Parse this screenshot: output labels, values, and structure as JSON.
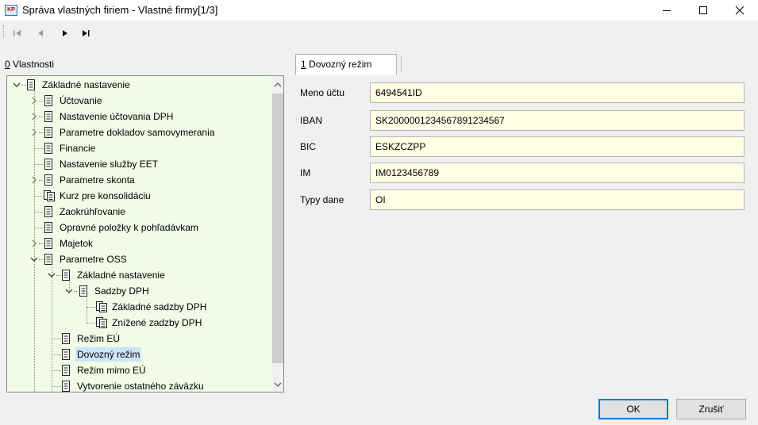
{
  "window": {
    "title": "Správa vlastných firiem - Vlastné firmy[1/3]",
    "app_icon_text": "KP"
  },
  "toolbar": {
    "nav": [
      "first-record",
      "previous-record",
      "next-record",
      "last-record"
    ]
  },
  "properties": {
    "label_prefix": "0",
    "label": " Vlastnosti"
  },
  "tree": {
    "items": [
      {
        "label": "Základné nastavenie",
        "level": 0,
        "expander": "expanded",
        "icon": "document-icon"
      },
      {
        "label": "Účtovanie",
        "level": 1,
        "expander": "collapsed",
        "icon": "document-icon"
      },
      {
        "label": "Nastavenie účtovania DPH",
        "level": 1,
        "expander": "collapsed",
        "icon": "document-icon"
      },
      {
        "label": "Parametre dokladov samovymerania",
        "level": 1,
        "expander": "collapsed",
        "icon": "document-icon"
      },
      {
        "label": "Financie",
        "level": 1,
        "expander": "none",
        "icon": "document-icon"
      },
      {
        "label": "Nastavenie služby EET",
        "level": 1,
        "expander": "none",
        "icon": "document-icon"
      },
      {
        "label": "Parametre skonta",
        "level": 1,
        "expander": "collapsed",
        "icon": "document-icon"
      },
      {
        "label": "Kurz pre konsolidáciu",
        "level": 1,
        "expander": "none",
        "icon": "documents-icon"
      },
      {
        "label": "Zaokrúhľovanie",
        "level": 1,
        "expander": "none",
        "icon": "document-icon"
      },
      {
        "label": "Opravné položky k pohľadávkam",
        "level": 1,
        "expander": "none",
        "icon": "document-icon"
      },
      {
        "label": "Majetok",
        "level": 1,
        "expander": "collapsed",
        "icon": "document-icon"
      },
      {
        "label": "Parametre OSS",
        "level": 1,
        "expander": "expanded",
        "icon": "document-icon"
      },
      {
        "label": "Základné nastavenie",
        "level": 2,
        "expander": "expanded",
        "icon": "document-icon"
      },
      {
        "label": "Sadzby DPH",
        "level": 3,
        "expander": "expanded",
        "icon": "document-icon"
      },
      {
        "label": "Základné sadzby DPH",
        "level": 4,
        "expander": "none",
        "icon": "documents-icon"
      },
      {
        "label": "Znížené zadzby DPH",
        "level": 4,
        "expander": "none",
        "icon": "documents-icon"
      },
      {
        "label": "Režim EÚ",
        "level": 2,
        "expander": "none",
        "icon": "document-icon"
      },
      {
        "label": "Dovozný režim",
        "level": 2,
        "expander": "none",
        "icon": "document-icon",
        "selected": true
      },
      {
        "label": "Režim mimo EÚ",
        "level": 2,
        "expander": "none",
        "icon": "document-icon"
      },
      {
        "label": "Vytvorenie ostatného záväzku",
        "level": 2,
        "expander": "none",
        "icon": "document-icon"
      }
    ]
  },
  "tab": {
    "prefix": "1",
    "label": " Dovozný režim"
  },
  "form": {
    "fields": [
      {
        "label": "Meno účtu",
        "value": "6494541ID"
      },
      {
        "label": "IBAN",
        "value": "SK2000001234567891234567"
      },
      {
        "label": "BIC",
        "value": "ESKZCZPP"
      },
      {
        "label": "IM",
        "value": "IM0123456789"
      },
      {
        "label": "Typy dane",
        "value": "OI"
      }
    ]
  },
  "buttons": {
    "ok": "OK",
    "cancel": "Zrušiť"
  },
  "colors": {
    "tree_background": "#f2fbe6",
    "input_background": "#ffffe4",
    "selection": "#cce4f7",
    "default_button_border": "#0078d7"
  }
}
